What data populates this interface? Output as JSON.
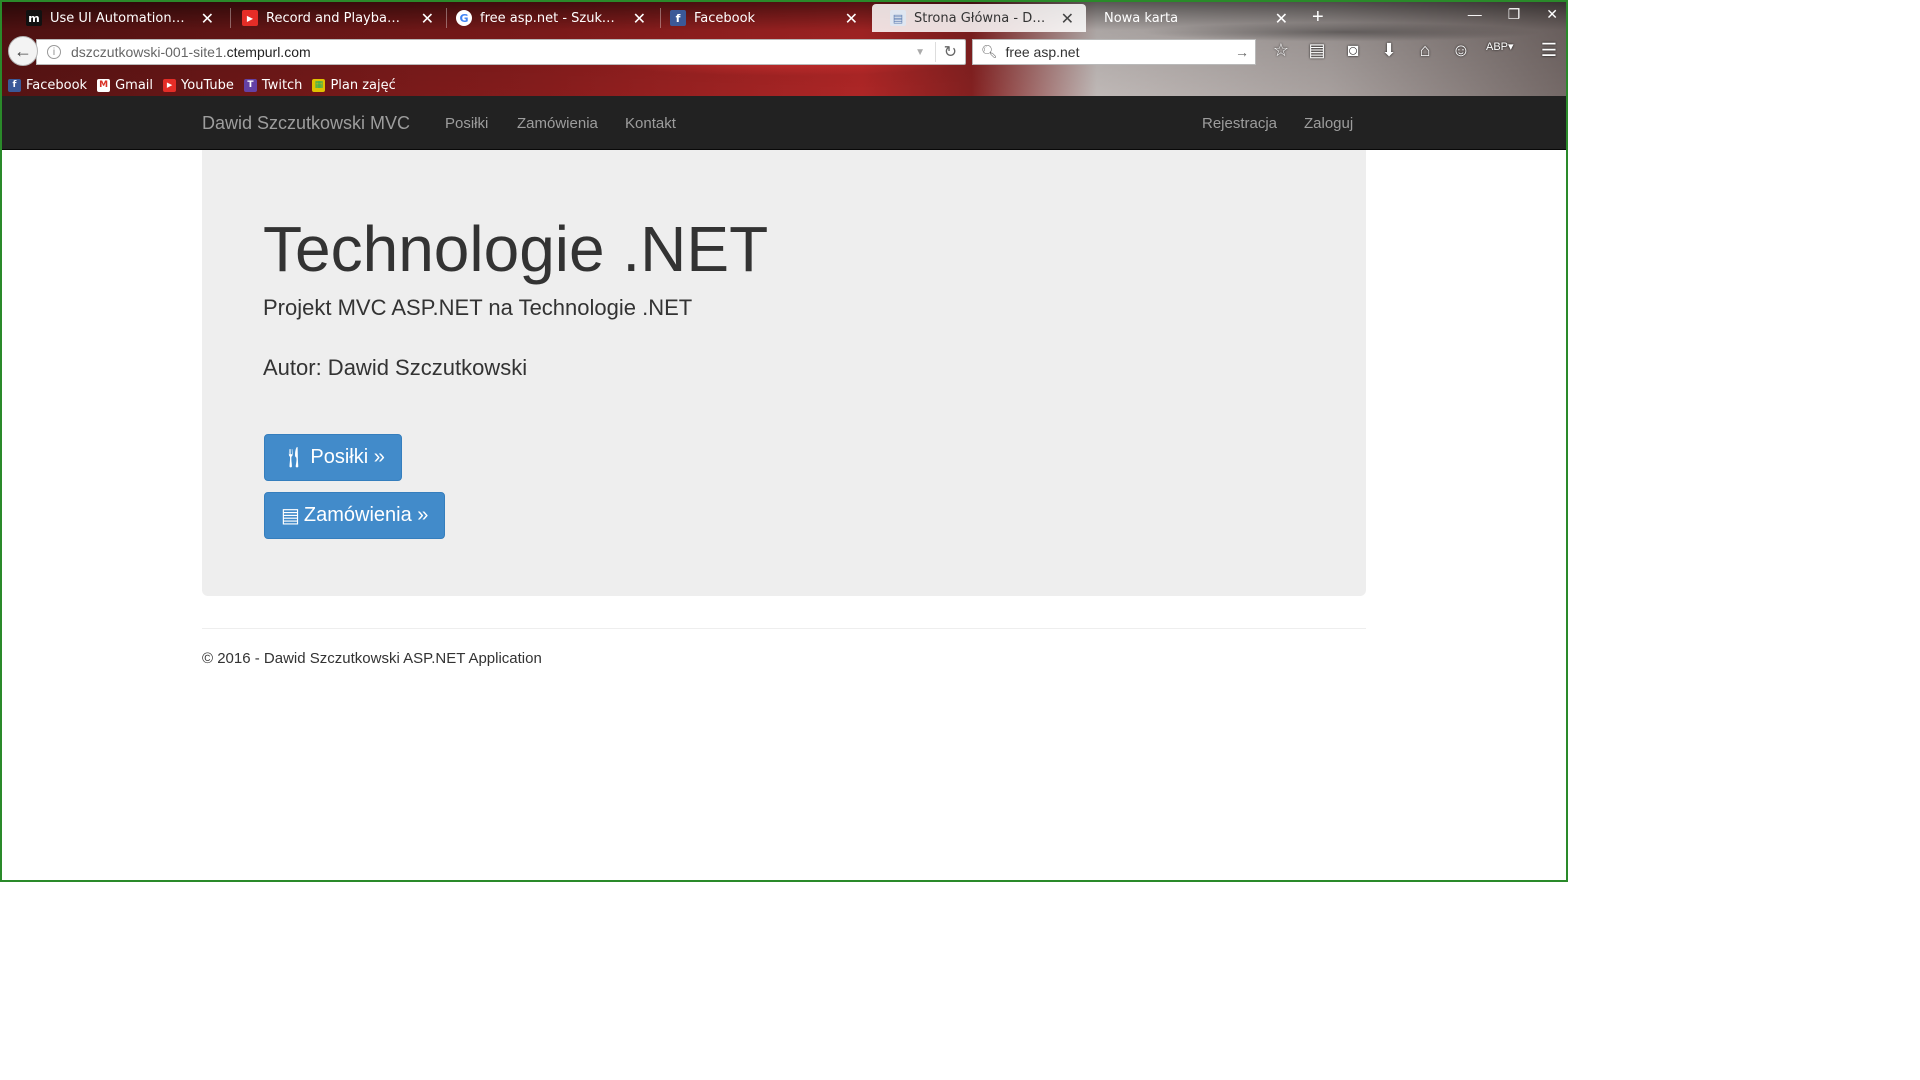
{
  "browser": {
    "tabs": [
      {
        "title": "Use UI Automation To Tes...",
        "favicon": "m",
        "favicon_color": "#111111",
        "active": false
      },
      {
        "title": "Record and Playback in C...",
        "favicon": "▶",
        "favicon_color": "#e52d27",
        "active": false
      },
      {
        "title": "free asp.net - Szukaj w Go...",
        "favicon": "G",
        "favicon_color": "#4285f4",
        "active": false
      },
      {
        "title": "Facebook",
        "favicon": "f",
        "favicon_color": "#3b5998",
        "active": false
      },
      {
        "title": "Strona Główna - Dawid Sz...",
        "favicon": "▤",
        "favicon_color": "#8fa6c8",
        "active": true
      },
      {
        "title": "Nowa karta",
        "favicon": "",
        "favicon_color": "",
        "active": false
      }
    ],
    "url_prefix": "dszczutkowski-001-site1.",
    "url_host": "ctempurl.com",
    "search_value": "free asp.net",
    "bookmarks": [
      {
        "label": "Facebook",
        "icon": "f",
        "color": "#3b5998"
      },
      {
        "label": "Gmail",
        "icon": "M",
        "color": "#d93025"
      },
      {
        "label": "YouTube",
        "icon": "▶",
        "color": "#e52d27"
      },
      {
        "label": "Twitch",
        "icon": "T",
        "color": "#6441a5"
      },
      {
        "label": "Plan zajęć",
        "icon": "▦",
        "color": "#c8a800"
      }
    ]
  },
  "site": {
    "brand": "Dawid Szczutkowski MVC",
    "nav_links": [
      "Posiłki",
      "Zamówienia",
      "Kontakt"
    ],
    "nav_right": [
      "Rejestracja",
      "Zaloguj"
    ],
    "heading": "Technologie .NET",
    "subtitle": "Projekt MVC ASP.NET na Technologie .NET",
    "author": "Autor: Dawid Szczutkowski",
    "btn_meals": "Posiłki »",
    "btn_orders": "Zamówienia »",
    "footer": "© 2016 - Dawid Szczutkowski ASP.NET Application"
  }
}
